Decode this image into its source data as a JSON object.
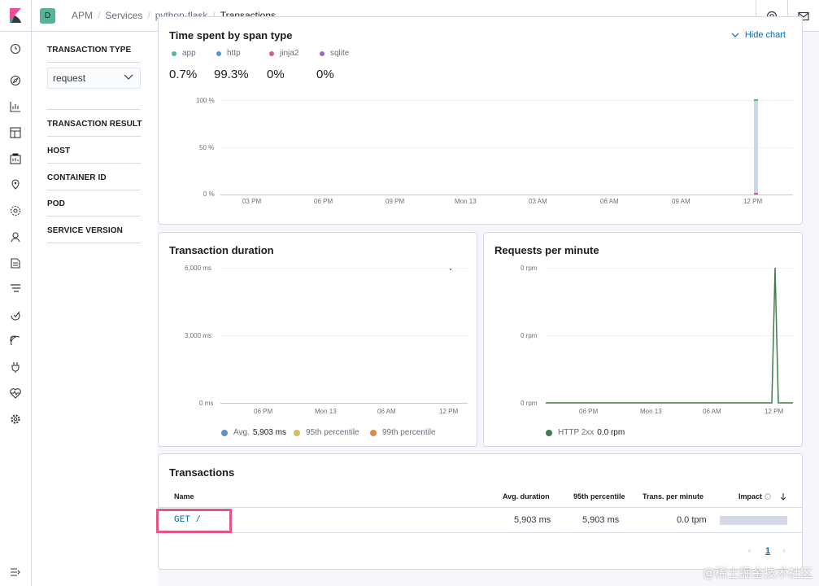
{
  "topbar": {
    "space_initial": "D",
    "breadcrumbs": [
      "APM",
      "Services",
      "python-flask",
      "Transactions"
    ]
  },
  "filters": {
    "transaction_type_label": "TRANSACTION TYPE",
    "transaction_type_value": "request",
    "sections": [
      "TRANSACTION RESULT",
      "HOST",
      "CONTAINER ID",
      "POD",
      "SERVICE VERSION"
    ]
  },
  "span_chart": {
    "title": "Time spent by span type",
    "hide_label": "Hide chart",
    "legend": [
      {
        "name": "app",
        "value": "0.7%",
        "color": "#54b399"
      },
      {
        "name": "http",
        "value": "99.3%",
        "color": "#6092c0"
      },
      {
        "name": "jinja2",
        "value": "0%",
        "color": "#d36086"
      },
      {
        "name": "sqlite",
        "value": "0%",
        "color": "#9170b8"
      }
    ],
    "y_ticks": [
      "100 %",
      "50 %",
      "0 %"
    ],
    "x_ticks": [
      "03 PM",
      "06 PM",
      "09 PM",
      "Mon 13",
      "03 AM",
      "06 AM",
      "09 AM",
      "12 PM"
    ]
  },
  "chart_data": [
    {
      "type": "area",
      "title": "Time spent by span type",
      "x": [
        "12 PM"
      ],
      "series": [
        {
          "name": "app",
          "values": [
            0.7
          ]
        },
        {
          "name": "http",
          "values": [
            99.3
          ]
        },
        {
          "name": "jinja2",
          "values": [
            0
          ]
        },
        {
          "name": "sqlite",
          "values": [
            0
          ]
        }
      ],
      "ylim": [
        0,
        100
      ]
    },
    {
      "type": "line",
      "title": "Transaction duration",
      "series": [
        {
          "name": "Avg.",
          "values": [
            5903
          ]
        }
      ],
      "ylim": [
        0,
        6000
      ]
    },
    {
      "type": "line",
      "title": "Requests per minute",
      "series": [
        {
          "name": "HTTP 2xx",
          "values": [
            0
          ]
        }
      ]
    }
  ],
  "duration_chart": {
    "title": "Transaction duration",
    "y_ticks": [
      "6,000 ms",
      "3,000 ms",
      "0 ms"
    ],
    "x_ticks": [
      "06 PM",
      "Mon 13",
      "06 AM",
      "12 PM"
    ],
    "legend": [
      {
        "name": "Avg.",
        "value": "5,903 ms",
        "color": "#6092c0"
      },
      {
        "name": "95th percentile",
        "value": "",
        "color": "#d6bf57"
      },
      {
        "name": "99th percentile",
        "value": "",
        "color": "#da8b45"
      }
    ]
  },
  "rpm_chart": {
    "title": "Requests per minute",
    "y_ticks": [
      "0 rpm",
      "0 rpm",
      "0 rpm"
    ],
    "x_ticks": [
      "06 PM",
      "Mon 13",
      "06 AM",
      "12 PM"
    ],
    "legend": [
      {
        "name": "HTTP 2xx",
        "value": "0.0 rpm",
        "color": "#3f7d4a"
      }
    ]
  },
  "transactions": {
    "title": "Transactions",
    "columns": [
      "Name",
      "Avg. duration",
      "95th percentile",
      "Trans. per minute",
      "Impact"
    ],
    "rows": [
      {
        "name": "GET /",
        "avg": "5,903 ms",
        "p95": "5,903 ms",
        "tpm": "0.0 tpm",
        "impact": 1.0
      }
    ],
    "page": "1"
  },
  "watermark": "@稀土掘金技术社区"
}
